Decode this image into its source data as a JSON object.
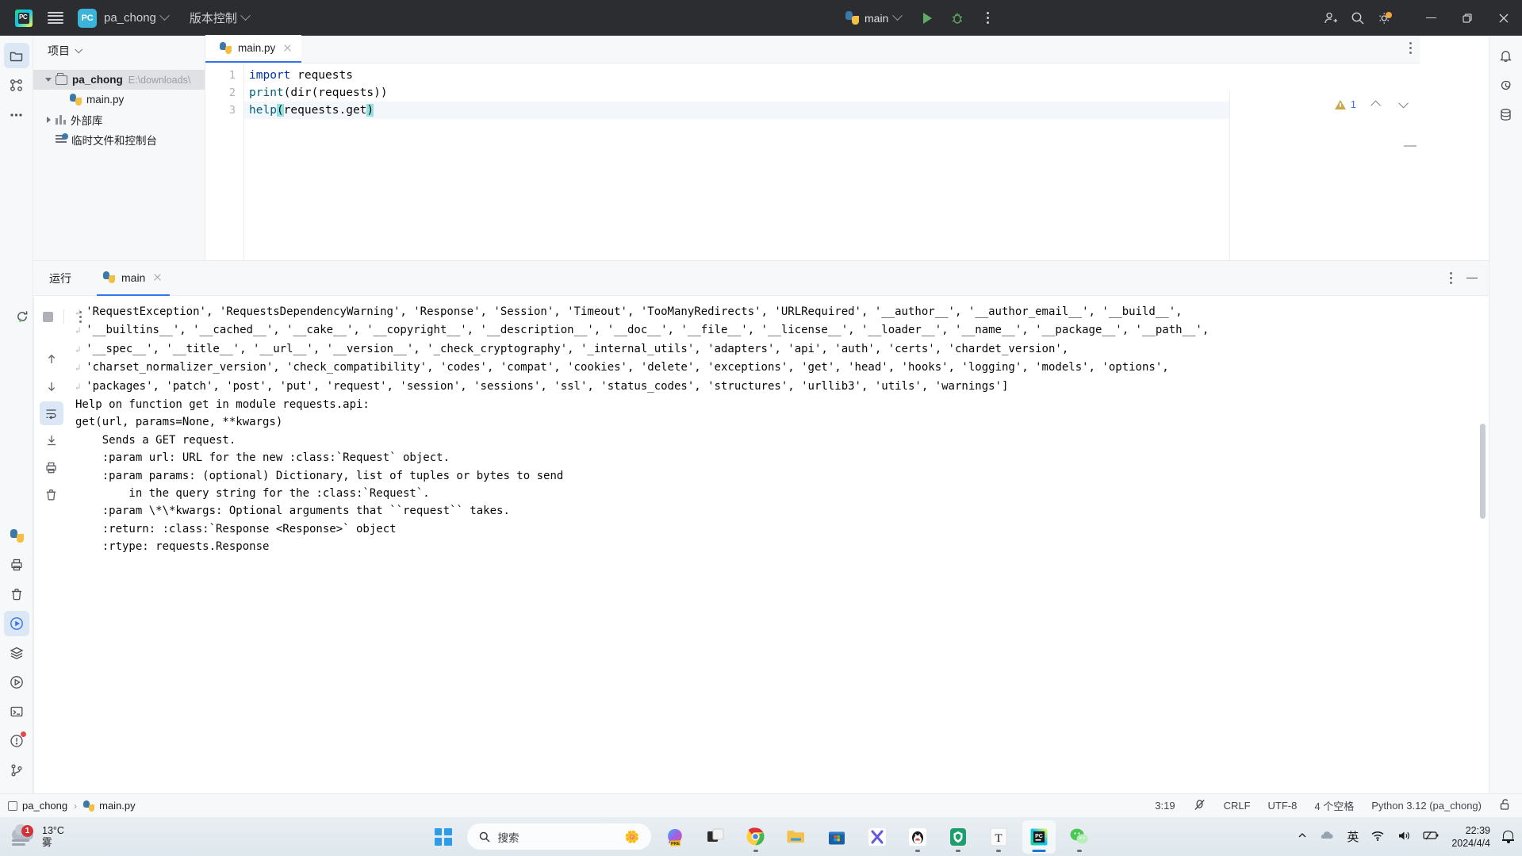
{
  "titlebar": {
    "jetbrains_logo": "jetbrains-logo",
    "menu_label": "main-menu",
    "project_badge": "PC",
    "project_name": "pa_chong",
    "vcs_label": "版本控制",
    "run_config": "main",
    "window_buttons": {
      "minimize": "—",
      "maximize": "❐",
      "close": "✕"
    }
  },
  "left_rail": {
    "items": [
      {
        "name": "project-tool-window",
        "icon": "folder-icon",
        "active": true
      },
      {
        "name": "structure-tool-window",
        "icon": "structure-icon",
        "active": false
      },
      {
        "name": "more-tool-windows",
        "icon": "ellipsis-icon",
        "active": false
      }
    ],
    "bottom_items": [
      {
        "name": "python-packages",
        "icon": "python-icon"
      },
      {
        "name": "print-icon",
        "icon": "printer-icon"
      },
      {
        "name": "delete-icon",
        "icon": "trash-icon"
      },
      {
        "name": "run-tool-window",
        "icon": "run-icon",
        "active": true
      },
      {
        "name": "services-tool-window",
        "icon": "layers-icon"
      },
      {
        "name": "python-console",
        "icon": "python-console-icon"
      },
      {
        "name": "terminal-tool-window",
        "icon": "terminal-icon"
      },
      {
        "name": "problems-tool-window",
        "icon": "problems-icon"
      },
      {
        "name": "version-control-tool-window",
        "icon": "git-branch-icon"
      }
    ]
  },
  "right_rail": {
    "items": [
      {
        "name": "notifications",
        "icon": "bell-icon"
      },
      {
        "name": "ai-assistant",
        "icon": "spiral-icon"
      },
      {
        "name": "database",
        "icon": "database-icon"
      }
    ]
  },
  "project_panel": {
    "title": "项目",
    "tree": [
      {
        "label": "pa_chong",
        "path": "E:\\downloads\\",
        "icon": "folder-icon",
        "expanded": true,
        "selected": true,
        "indent": 0
      },
      {
        "label": "main.py",
        "path": "",
        "icon": "python-file-icon",
        "expanded": null,
        "selected": false,
        "indent": 1
      },
      {
        "label": "外部库",
        "path": "",
        "icon": "library-icon",
        "expanded": false,
        "selected": false,
        "indent": 0
      },
      {
        "label": "临时文件和控制台",
        "path": "",
        "icon": "scratches-icon",
        "expanded": null,
        "selected": false,
        "indent": 0
      }
    ]
  },
  "editor": {
    "tabs": [
      {
        "label": "main.py",
        "icon": "python-file-icon",
        "active": true
      }
    ],
    "warning_count": "1",
    "lines": [
      {
        "num": "1",
        "segments": [
          {
            "t": "import",
            "c": "kw"
          },
          {
            "t": " requests",
            "c": ""
          }
        ],
        "current": false
      },
      {
        "num": "2",
        "segments": [
          {
            "t": "print",
            "c": "fn"
          },
          {
            "t": "(dir(requests))",
            "c": ""
          }
        ],
        "current": false
      },
      {
        "num": "3",
        "segments": [
          {
            "t": "help",
            "c": "fn"
          },
          {
            "t": "(",
            "c": "brhl"
          },
          {
            "t": "requests.get",
            "c": ""
          },
          {
            "t": ")",
            "c": "brhl"
          }
        ],
        "current": true
      }
    ]
  },
  "run_panel": {
    "title": "运行",
    "tab_label": "main",
    "toolbar_buttons": [
      {
        "name": "rerun-button",
        "icon": "rerun-icon"
      },
      {
        "name": "stop-button",
        "icon": "stop-icon"
      },
      {
        "name": "more-options-button",
        "icon": "ellipsis-vertical-icon"
      }
    ],
    "side_buttons": [
      {
        "name": "scroll-up-button",
        "icon": "arrow-up-icon"
      },
      {
        "name": "scroll-down-button",
        "icon": "arrow-down-icon"
      },
      {
        "name": "soft-wrap-button",
        "icon": "soft-wrap-icon",
        "active": true
      },
      {
        "name": "scroll-to-end-button",
        "icon": "scroll-end-icon"
      },
      {
        "name": "print-button",
        "icon": "printer-icon"
      },
      {
        "name": "clear-all-button",
        "icon": "trash-icon"
      }
    ],
    "console_lines": [
      {
        "text": "'RequestException', 'RequestsDependencyWarning', 'Response', 'Session', 'Timeout', 'TooManyRedirects', 'URLRequired', '__author__', '__author_email__', '__build__',",
        "wrap_start": true,
        "wrap_end": true
      },
      {
        "text": "'__builtins__', '__cached__', '__cake__', '__copyright__', '__description__', '__doc__', '__file__', '__license__', '__loader__', '__name__', '__package__', '__path__',",
        "wrap_start": true,
        "wrap_end": true
      },
      {
        "text": "'__spec__', '__title__', '__url__', '__version__', '_check_cryptography', '_internal_utils', 'adapters', 'api', 'auth', 'certs', 'chardet_version',",
        "wrap_start": true,
        "wrap_end": true
      },
      {
        "text": "'charset_normalizer_version', 'check_compatibility', 'codes', 'compat', 'cookies', 'delete', 'exceptions', 'get', 'head', 'hooks', 'logging', 'models', 'options',",
        "wrap_start": true,
        "wrap_end": true
      },
      {
        "text": "'packages', 'patch', 'post', 'put', 'request', 'session', 'sessions', 'ssl', 'status_codes', 'structures', 'urllib3', 'utils', 'warnings']",
        "wrap_start": true,
        "wrap_end": false
      },
      {
        "text": "Help on function get in module requests.api:",
        "wrap_start": false,
        "wrap_end": false
      },
      {
        "text": "",
        "wrap_start": false,
        "wrap_end": false
      },
      {
        "text": "get(url, params=None, **kwargs)",
        "wrap_start": false,
        "wrap_end": false
      },
      {
        "text": "    Sends a GET request.",
        "wrap_start": false,
        "wrap_end": false
      },
      {
        "text": "",
        "wrap_start": false,
        "wrap_end": false
      },
      {
        "text": "    :param url: URL for the new :class:`Request` object.",
        "wrap_start": false,
        "wrap_end": false
      },
      {
        "text": "    :param params: (optional) Dictionary, list of tuples or bytes to send",
        "wrap_start": false,
        "wrap_end": false
      },
      {
        "text": "        in the query string for the :class:`Request`.",
        "wrap_start": false,
        "wrap_end": false
      },
      {
        "text": "    :param \\*\\*kwargs: Optional arguments that ``request`` takes.",
        "wrap_start": false,
        "wrap_end": false
      },
      {
        "text": "    :return: :class:`Response <Response>` object",
        "wrap_start": false,
        "wrap_end": false
      },
      {
        "text": "    :rtype: requests.Response",
        "wrap_start": false,
        "wrap_end": false
      }
    ]
  },
  "statusbar": {
    "breadcrumb": [
      "pa_chong",
      "main.py"
    ],
    "caret_position": "3:19",
    "line_separator": "CRLF",
    "encoding": "UTF-8",
    "indent": "4 个空格",
    "interpreter": "Python 3.12 (pa_chong)",
    "lock_icon": "unlocked-icon"
  },
  "taskbar": {
    "weather_temp": "13°C",
    "weather_desc": "雾",
    "weather_badge": "1",
    "search_placeholder": "搜索",
    "apps": [
      {
        "name": "taskbar-app-copilot",
        "label": "Copilot PRE"
      },
      {
        "name": "taskbar-app-task-view",
        "label": "Task View"
      },
      {
        "name": "taskbar-app-chrome",
        "label": "Google Chrome"
      },
      {
        "name": "taskbar-app-file-explorer",
        "label": "File Explorer"
      },
      {
        "name": "taskbar-app-microsoft-store",
        "label": "Microsoft Store"
      },
      {
        "name": "taskbar-app-xmind",
        "label": "Xmind"
      },
      {
        "name": "taskbar-app-qq",
        "label": "QQ"
      },
      {
        "name": "taskbar-app-green-shield",
        "label": "Security"
      },
      {
        "name": "taskbar-app-typora",
        "label": "Typora"
      },
      {
        "name": "taskbar-app-pycharm",
        "label": "PyCharm"
      },
      {
        "name": "taskbar-app-wechat",
        "label": "WeChat"
      }
    ],
    "tray": {
      "ime": "英",
      "time": "22:39",
      "date": "2024/4/4"
    }
  }
}
